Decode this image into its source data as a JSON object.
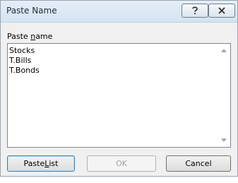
{
  "window": {
    "title": "Paste Name",
    "help_icon": "help-icon",
    "close_icon": "close-icon"
  },
  "paste_name": {
    "label_prefix": "Paste ",
    "label_mnemonic": "n",
    "label_suffix": "ame",
    "items": [
      "Stocks",
      "T.Bills",
      "T.Bonds"
    ]
  },
  "buttons": {
    "paste_list_prefix": "Paste ",
    "paste_list_mnemonic": "L",
    "paste_list_suffix": "ist",
    "ok": "OK",
    "cancel": "Cancel"
  }
}
